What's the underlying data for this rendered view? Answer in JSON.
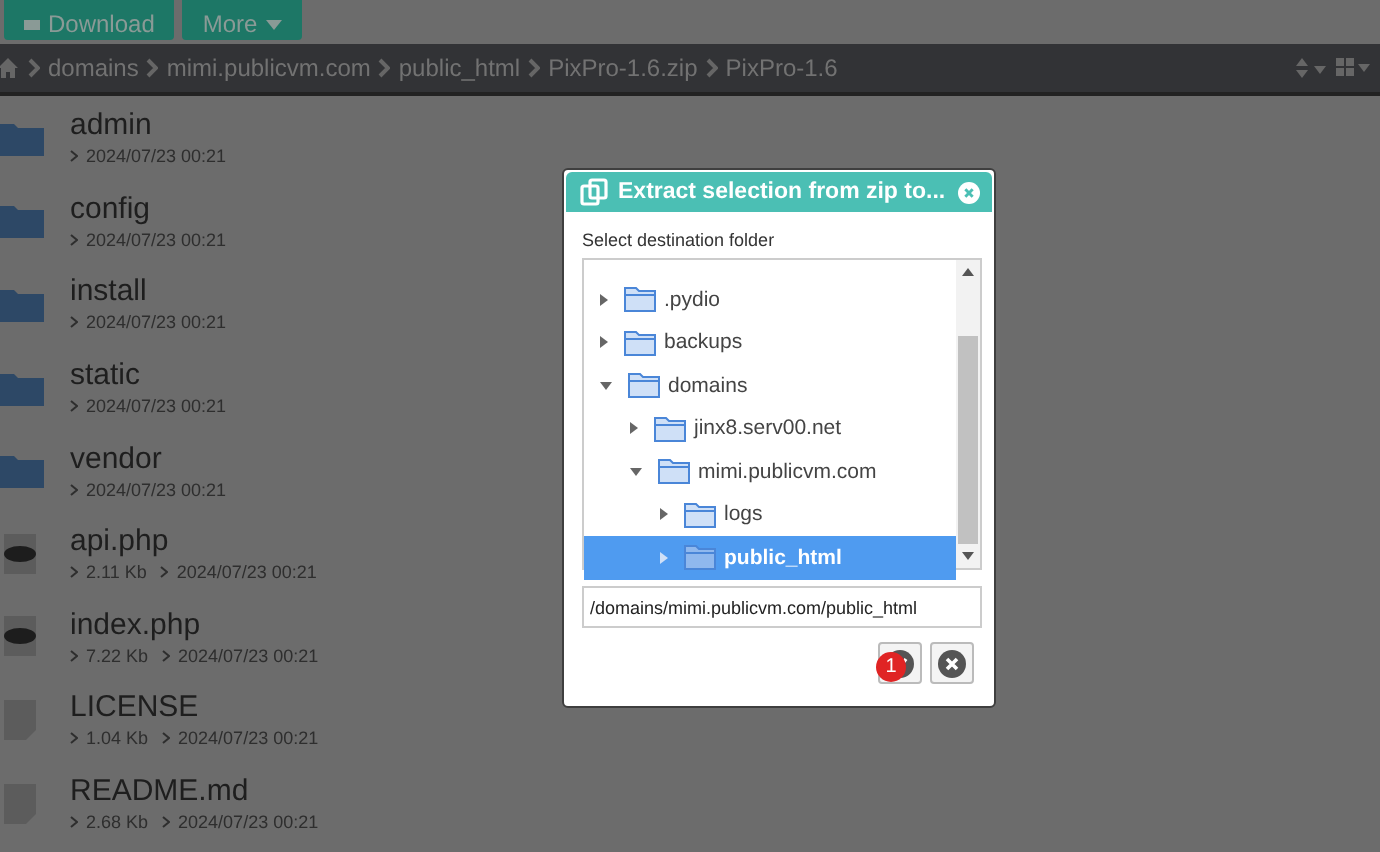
{
  "toolbar": {
    "buttons": [
      {
        "label": "Download",
        "kind": "download"
      },
      {
        "label": "More",
        "kind": "menu"
      }
    ]
  },
  "breadcrumb": [
    "domains",
    "mimi.publicvm.com",
    "public_html",
    "PixPro-1.6.zip",
    "PixPro-1.6"
  ],
  "files": [
    {
      "name": "admin",
      "kind": "folder",
      "date": "2024/07/23 00:21"
    },
    {
      "name": "config",
      "kind": "folder",
      "date": "2024/07/23 00:21"
    },
    {
      "name": "install",
      "kind": "folder",
      "date": "2024/07/23 00:21"
    },
    {
      "name": "static",
      "kind": "folder",
      "date": "2024/07/23 00:21"
    },
    {
      "name": "vendor",
      "kind": "folder",
      "date": "2024/07/23 00:21"
    },
    {
      "name": "api.php",
      "kind": "php",
      "size": "2.11 Kb",
      "date": "2024/07/23 00:21"
    },
    {
      "name": "index.php",
      "kind": "php",
      "size": "7.22 Kb",
      "date": "2024/07/23 00:21"
    },
    {
      "name": "LICENSE",
      "kind": "file",
      "size": "1.04 Kb",
      "date": "2024/07/23 00:21"
    },
    {
      "name": "README.md",
      "kind": "file",
      "size": "2.68 Kb",
      "date": "2024/07/23 00:21"
    }
  ],
  "dialog": {
    "title": "Extract selection from zip to...",
    "label": "Select destination folder",
    "tree": [
      {
        "name": ".pydio",
        "expanded": false,
        "selected": false
      },
      {
        "name": "backups",
        "expanded": false,
        "selected": false
      },
      {
        "name": "domains",
        "expanded": true,
        "selected": false,
        "children": [
          {
            "name": "jinx8.serv00.net",
            "expanded": false,
            "selected": false
          },
          {
            "name": "mimi.publicvm.com",
            "expanded": true,
            "selected": false,
            "children": [
              {
                "name": "logs",
                "expanded": false,
                "selected": false
              },
              {
                "name": "public_html",
                "expanded": false,
                "selected": true
              }
            ]
          }
        ]
      }
    ],
    "path": "/domains/mimi.publicvm.com/public_html",
    "badge": "1"
  }
}
